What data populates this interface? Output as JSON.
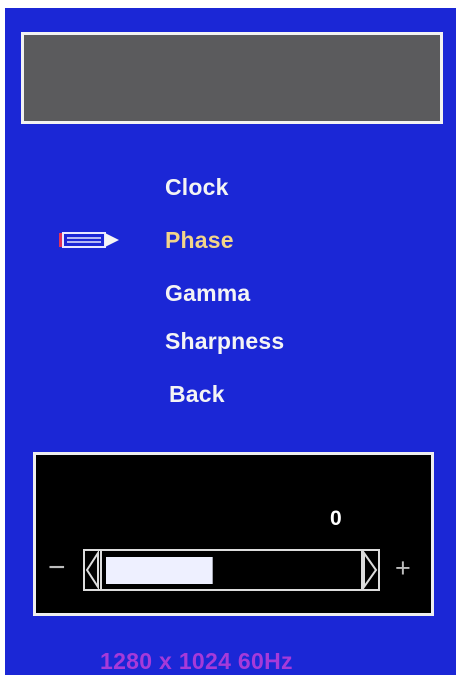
{
  "osd": {
    "menu": {
      "items": [
        {
          "label": "Clock",
          "selected": false
        },
        {
          "label": "Phase",
          "selected": true
        },
        {
          "label": "Gamma",
          "selected": false
        },
        {
          "label": "Sharpness",
          "selected": false
        },
        {
          "label": "Back",
          "selected": false
        }
      ]
    },
    "adjust": {
      "value": "0",
      "minus_symbol": "−",
      "plus_symbol": "+",
      "slider_level": 0.42
    },
    "resolution": "1280 x 1024  60Hz",
    "colors": {
      "background": "#1b27d6",
      "title_box": "#5b5b5d",
      "selected_text": "#f2d58a",
      "normal_text": "#f4f4f4",
      "resolution_text": "#a63ad9"
    },
    "icons": {
      "selector": "pencil-icon"
    }
  }
}
